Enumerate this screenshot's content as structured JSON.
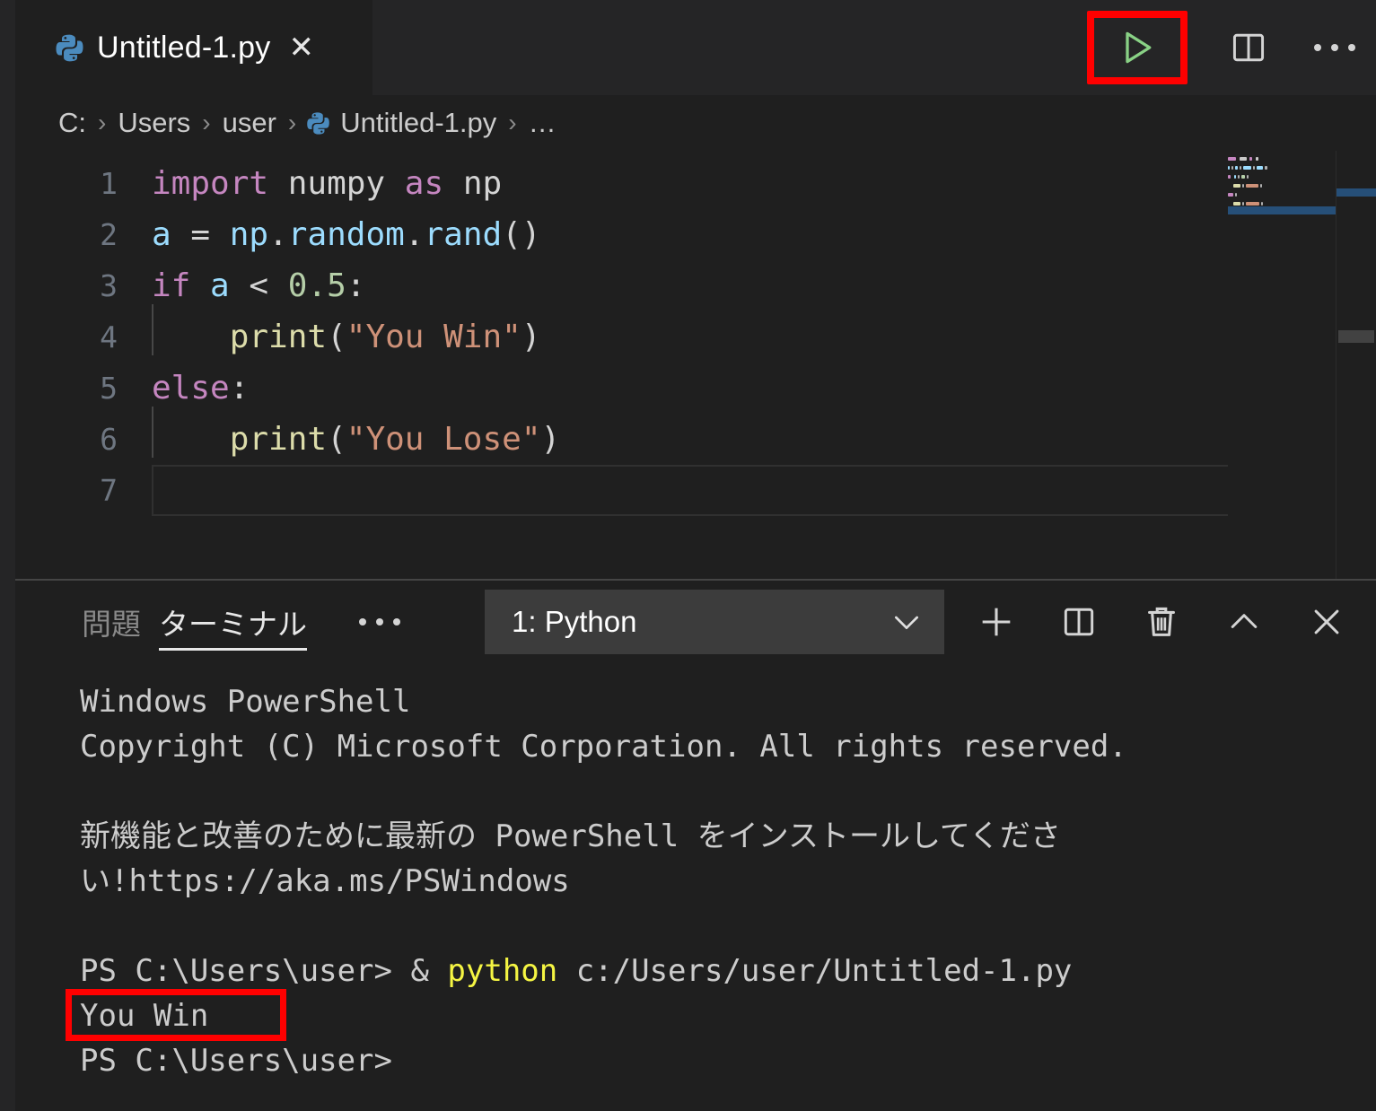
{
  "window": {
    "theme": "vscode-dark",
    "colors": {
      "background": "#1f1f1f",
      "tabbar": "#252526",
      "accent_annotation": "#ff0000",
      "run_icon": "#89d185",
      "python_icon": "#4b8bbe",
      "keyword": "#C586C0",
      "string": "#CE9178",
      "number": "#B5CEA8",
      "function": "#DCDCAA",
      "variable": "#9CDCFE",
      "terminal_text": "#cccccc",
      "terminal_yellow": "#f5f543",
      "selection": "#264f78"
    }
  },
  "tab": {
    "icon": "python-file-icon",
    "label": "Untitled-1.py",
    "close_glyph": "✕"
  },
  "editor_actions": {
    "run": {
      "name": "run-python-file-button",
      "icon": "play-triangle-icon",
      "annotated": true
    },
    "split": {
      "name": "split-editor-right-button",
      "icon": "split-editor-icon"
    },
    "more": {
      "name": "more-actions-button",
      "icon": "ellipsis-icon"
    }
  },
  "breadcrumb": {
    "separator": "›",
    "items": [
      {
        "label": "C:",
        "icon": null
      },
      {
        "label": "Users",
        "icon": null
      },
      {
        "label": "user",
        "icon": null
      },
      {
        "label": "Untitled-1.py",
        "icon": "python-file-icon"
      },
      {
        "label": "…",
        "icon": null
      }
    ]
  },
  "code": {
    "active_line": 7,
    "lines": [
      {
        "n": "1",
        "indent": 0,
        "tokens": [
          {
            "t": "import",
            "c": "k"
          },
          {
            "t": " ",
            "c": "pl"
          },
          {
            "t": "numpy",
            "c": "pl"
          },
          {
            "t": " ",
            "c": "pl"
          },
          {
            "t": "as",
            "c": "k"
          },
          {
            "t": " ",
            "c": "pl"
          },
          {
            "t": "np",
            "c": "pl"
          }
        ]
      },
      {
        "n": "2",
        "indent": 0,
        "tokens": [
          {
            "t": "a",
            "c": "id"
          },
          {
            "t": " = ",
            "c": "op"
          },
          {
            "t": "np",
            "c": "id"
          },
          {
            "t": ".",
            "c": "op"
          },
          {
            "t": "random",
            "c": "id"
          },
          {
            "t": ".",
            "c": "op"
          },
          {
            "t": "rand",
            "c": "id"
          },
          {
            "t": "()",
            "c": "op"
          }
        ]
      },
      {
        "n": "3",
        "indent": 0,
        "tokens": [
          {
            "t": "if",
            "c": "k"
          },
          {
            "t": " ",
            "c": "pl"
          },
          {
            "t": "a",
            "c": "id"
          },
          {
            "t": " < ",
            "c": "op"
          },
          {
            "t": "0.5",
            "c": "nu"
          },
          {
            "t": ":",
            "c": "op"
          }
        ]
      },
      {
        "n": "4",
        "indent": 1,
        "tokens": [
          {
            "t": "    ",
            "c": "pl"
          },
          {
            "t": "print",
            "c": "fn"
          },
          {
            "t": "(",
            "c": "op"
          },
          {
            "t": "\"You Win\"",
            "c": "st"
          },
          {
            "t": ")",
            "c": "op"
          }
        ]
      },
      {
        "n": "5",
        "indent": 0,
        "tokens": [
          {
            "t": "else",
            "c": "k"
          },
          {
            "t": ":",
            "c": "op"
          }
        ]
      },
      {
        "n": "6",
        "indent": 1,
        "tokens": [
          {
            "t": "    ",
            "c": "pl"
          },
          {
            "t": "print",
            "c": "fn"
          },
          {
            "t": "(",
            "c": "op"
          },
          {
            "t": "\"You Lose\"",
            "c": "st"
          },
          {
            "t": ")",
            "c": "op"
          }
        ]
      },
      {
        "n": "7",
        "indent": 0,
        "tokens": []
      }
    ]
  },
  "panel": {
    "tabs": [
      {
        "label": "問題",
        "name": "panel-tab-problems",
        "active": false
      },
      {
        "label": "ターミナル",
        "name": "panel-tab-terminal",
        "active": true
      }
    ],
    "more_label": "…",
    "terminal_select": {
      "value": "1: Python",
      "chevron": "chevron-down-icon"
    },
    "actions": [
      {
        "name": "new-terminal-button",
        "icon": "plus-icon"
      },
      {
        "name": "split-terminal-button",
        "icon": "split-icon"
      },
      {
        "name": "kill-terminal-button",
        "icon": "trash-icon"
      },
      {
        "name": "maximize-panel-button",
        "icon": "chevron-up-icon"
      },
      {
        "name": "close-panel-button",
        "icon": "close-icon"
      }
    ]
  },
  "terminal": {
    "lines": [
      {
        "text": "Windows PowerShell",
        "kind": "plain"
      },
      {
        "text": "Copyright (C) Microsoft Corporation. All rights reserved.",
        "kind": "plain"
      },
      {
        "text": "",
        "kind": "blank"
      },
      {
        "text": "新機能と改善のために最新の PowerShell をインストールしてください!https://aka.ms/PSWindows",
        "kind": "wrap"
      },
      {
        "text": "",
        "kind": "blank"
      },
      {
        "kind": "command",
        "prompt": "PS C:\\Users\\user> ",
        "amp": "& ",
        "cmd": "python",
        "args": " c:/Users/user/Untitled-1.py"
      },
      {
        "kind": "highlighted",
        "text": "You Win"
      },
      {
        "text": "PS C:\\Users\\user>",
        "kind": "plain"
      }
    ]
  }
}
